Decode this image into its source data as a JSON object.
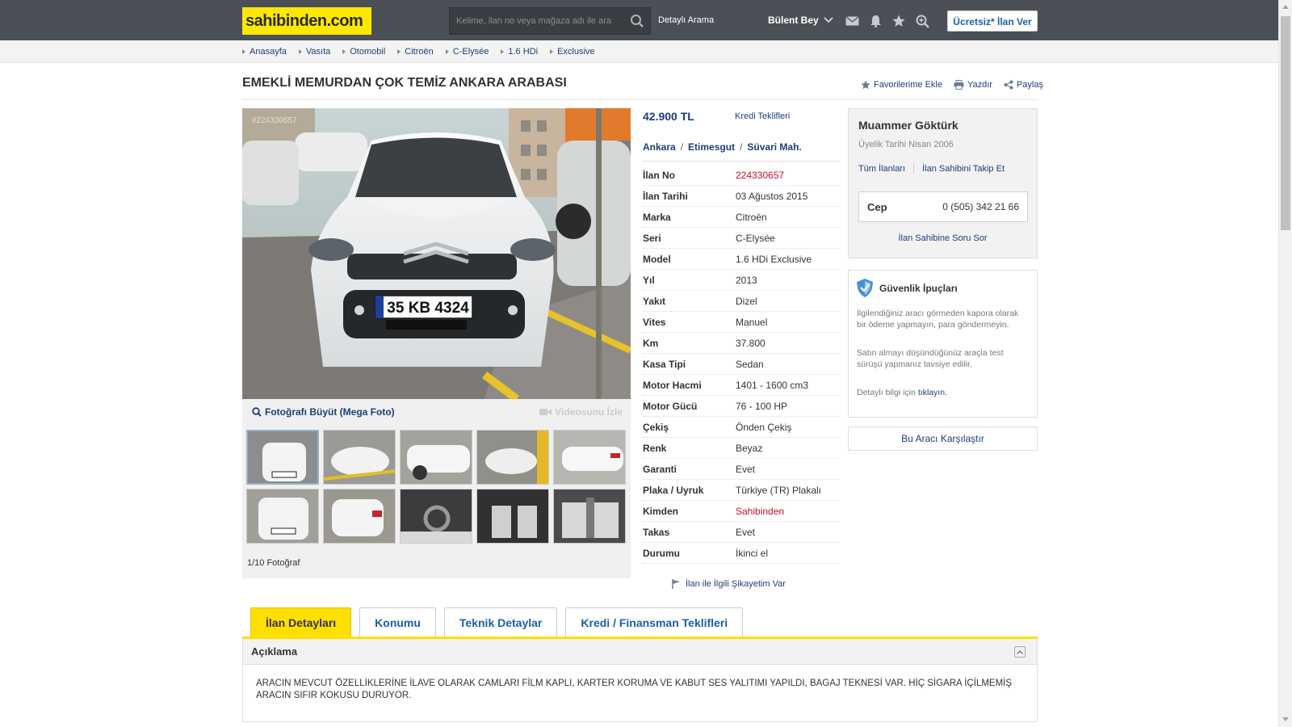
{
  "header": {
    "logo": "sahibinden.com",
    "search_placeholder": "Kelime, ilan no veya mağaza adı ile ara",
    "detailed_search": "Detaylı Arama",
    "user_name": "Bülent Bey",
    "post_ad": "Ücretsiz* İlan Ver"
  },
  "breadcrumb": [
    "Anasayfa",
    "Vasıta",
    "Otomobil",
    "Citroën",
    "C-Elysée",
    "1.6 HDi",
    "Exclusive"
  ],
  "listing": {
    "title": "EMEKLİ MEMURDAN ÇOK TEMİZ ANKARA ARABASI",
    "actions": {
      "favorite": "Favorilerime Ekle",
      "print": "Yazdır",
      "share": "Paylaş"
    },
    "photo_watermark_id": "#224330657",
    "plate": "35 KB 4324",
    "mega_photo": "Fotoğrafı Büyüt (Mega Foto)",
    "watch_video": "Videosunu İzle",
    "photo_count": "1/10 Fotoğraf",
    "price": "42.900 TL",
    "credit_offers": "Kredi Teklifleri",
    "location": [
      "Ankara",
      "Etimesgut",
      "Süvari Mah."
    ],
    "specs": [
      {
        "k": "İlan No",
        "v": "224330657",
        "red": true
      },
      {
        "k": "İlan Tarihi",
        "v": "03 Ağustos 2015"
      },
      {
        "k": "Marka",
        "v": "Citroën"
      },
      {
        "k": "Seri",
        "v": "C-Elysée"
      },
      {
        "k": "Model",
        "v": "1.6 HDi Exclusive"
      },
      {
        "k": "Yıl",
        "v": "2013"
      },
      {
        "k": "Yakıt",
        "v": "Dizel"
      },
      {
        "k": "Vites",
        "v": "Manuel"
      },
      {
        "k": "Km",
        "v": "37.800"
      },
      {
        "k": "Kasa Tipi",
        "v": "Sedan"
      },
      {
        "k": "Motor Hacmi",
        "v": "1401 - 1600 cm3"
      },
      {
        "k": "Motor Gücü",
        "v": "76 - 100 HP"
      },
      {
        "k": "Çekiş",
        "v": "Önden Çekiş"
      },
      {
        "k": "Renk",
        "v": "Beyaz"
      },
      {
        "k": "Garanti",
        "v": "Evet"
      },
      {
        "k": "Plaka / Uyruk",
        "v": "Türkiye (TR) Plakalı"
      },
      {
        "k": "Kimden",
        "v": "Sahibinden",
        "red": true
      },
      {
        "k": "Takas",
        "v": "Evet"
      },
      {
        "k": "Durumu",
        "v": "İkinci el"
      }
    ],
    "complaint": "İlan ile İlgili Şikayetim Var"
  },
  "seller": {
    "name": "Muammer Göktürk",
    "member_since": "Üyelik Tarihi  Nisan 2006",
    "all_ads": "Tüm İlanları",
    "follow": "İlan Sahibini Takip Et",
    "phone_label": "Cep",
    "phone": "0 (505) 342 21 66",
    "ask": "İlan Sahibine Soru Sor"
  },
  "safety": {
    "title": "Güvenlik İpuçları",
    "tip1": "İlgilendiğiniz aracı görmeden kapora olarak bir ödeme yapmayın, para göndermeyin.",
    "tip2": "Satın almayı düşündüğünüz araçla test sürüşü yapmanız tavsiye edilir.",
    "more_prefix": "Detaylı bilgi için ",
    "more_link": "tıklayın."
  },
  "compare": "Bu Aracı Karşılaştır",
  "tabs": [
    "İlan Detayları",
    "Konumu",
    "Teknik Detaylar",
    "Kredi / Finansman Teklifleri"
  ],
  "description": {
    "heading": "Açıklama",
    "text": "ARACIN MEVCUT ÖZELLİKLERİNE İLAVE OLARAK CAMLARI FİLM KAPLI, KARTER KORUMA VE KABUT SES YALITIMI YAPILDI, BAGAJ TEKNESİ VAR. HİÇ SİGARA İÇİLMEMİŞ ARACIN SIFIR KOKUSU DURUYOR."
  },
  "colors": {
    "header_bg": "#4b5056",
    "brand_yellow": "#ffe800",
    "link_blue": "#1a3f7a",
    "accent_red": "#c8102e"
  }
}
